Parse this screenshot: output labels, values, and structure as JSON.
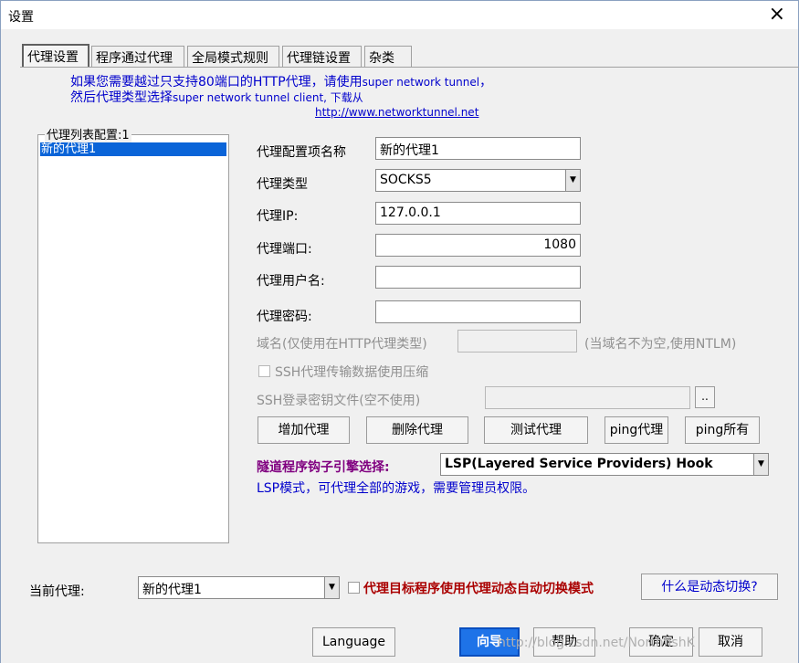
{
  "window": {
    "title": "设置",
    "close_icon": "×"
  },
  "tabs": [
    {
      "label": "代理设置"
    },
    {
      "label": "程序通过代理"
    },
    {
      "label": "全局模式规则"
    },
    {
      "label": "代理链设置"
    },
    {
      "label": "杂类"
    }
  ],
  "info": {
    "line1_a": "如果您需要越过只支持80端口的HTTP代理，请使用",
    "line1_b": "super network tunnel",
    "line1_c": "，",
    "line2_a": "然后代理类型选择",
    "line2_b": "super network tunnel client, 下载从",
    "url": "http://www.networktunnel.net"
  },
  "proxy_list": {
    "label": "代理列表配置:1",
    "items": [
      "新的代理1"
    ]
  },
  "form": {
    "name_label": "代理配置项名称",
    "name_value": "新的代理1",
    "type_label": "代理类型",
    "type_value": "SOCKS5",
    "ip_label": "代理IP:",
    "ip_value": "127.0.0.1",
    "port_label": "代理端口:",
    "port_value": "1080",
    "user_label": "代理用户名:",
    "user_value": "",
    "pass_label": "代理密码:",
    "pass_value": "",
    "domain_label": "域名(仅使用在HTTP代理类型)",
    "domain_value": "",
    "domain_hint": "(当域名不为空,使用NTLM)",
    "ssh_compress_label": "SSH代理传输数据使用压缩",
    "ssh_key_label": "SSH登录密钥文件(空不使用)",
    "ssh_key_value": "",
    "browse_label": ".."
  },
  "actions": {
    "add": "增加代理",
    "delete": "删除代理",
    "test": "测试代理",
    "ping": "ping代理",
    "ping_all": "ping所有"
  },
  "engine": {
    "label": "隧道程序钩子引擎选择:",
    "value": "LSP(Layered Service Providers) Hook",
    "note": "LSP模式，可代理全部的游戏，需要管理员权限。"
  },
  "current": {
    "label": "当前代理:",
    "value": "新的代理1",
    "auto_switch_label": "代理目标程序使用代理动态自动切换模式",
    "what_label": "什么是动态切换?"
  },
  "bottom": {
    "language": "Language",
    "wizard": "向导",
    "help": "帮助",
    "ok": "确定",
    "cancel": "取消",
    "watermark": "http://blog.csdn.net/NorthfishK"
  }
}
